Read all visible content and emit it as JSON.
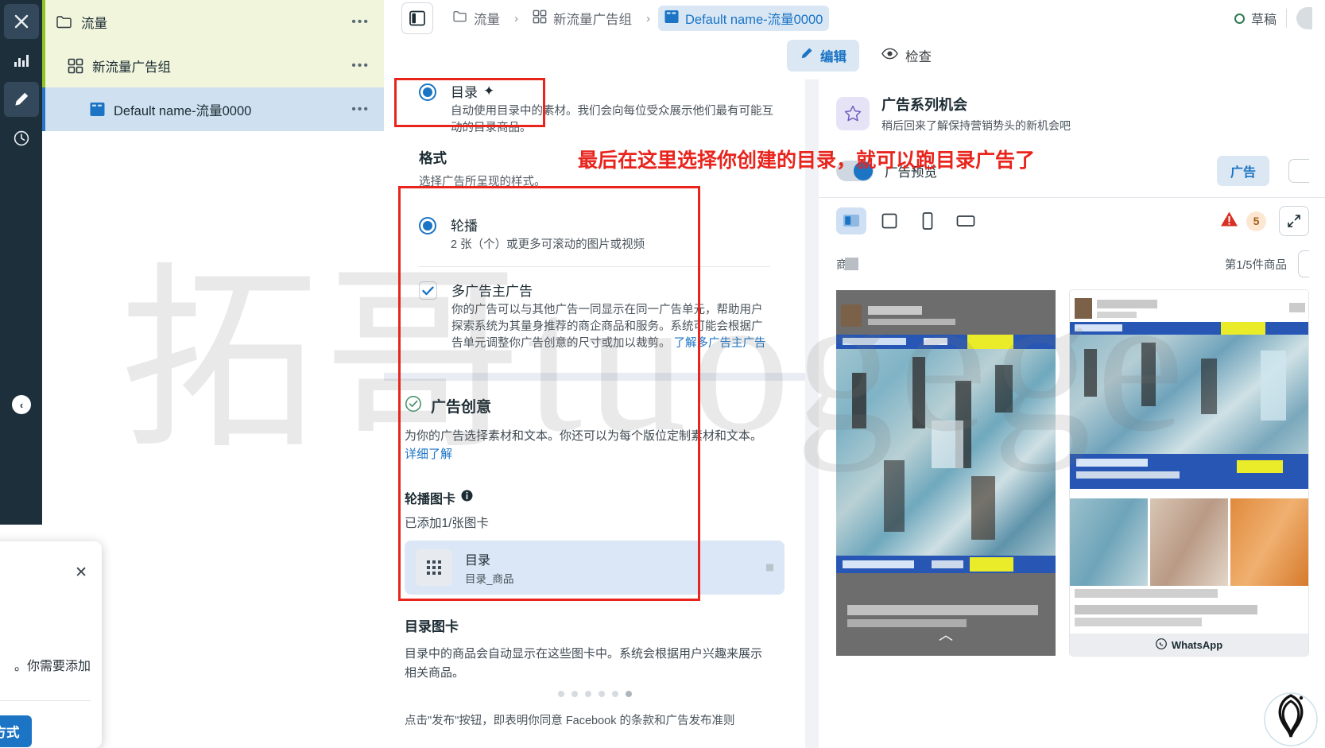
{
  "watermark": "拓哥tuogege",
  "rail": {
    "items": [
      {
        "name": "close-icon",
        "label": "关闭"
      },
      {
        "name": "chart-icon",
        "label": "数据"
      },
      {
        "name": "pencil-icon",
        "label": "编辑"
      },
      {
        "name": "clock-icon",
        "label": "历史"
      }
    ],
    "collapse_label": "‹"
  },
  "tree": {
    "rows": [
      {
        "icon": "folder-icon",
        "label": "流量",
        "level": 1,
        "menu": "•••"
      },
      {
        "icon": "adset-grid-icon",
        "label": "新流量广告组",
        "level": 2,
        "menu": "•••"
      },
      {
        "icon": "ad-card-icon",
        "label": "Default name-流量0000",
        "level": 3,
        "menu": "•••"
      }
    ]
  },
  "topbar": {
    "panel_toggle": "panel-toggle-icon",
    "breadcrumbs": [
      {
        "icon": "folder-icon",
        "label": "流量",
        "current": false
      },
      {
        "icon": "adset-grid-icon",
        "label": "新流量广告组",
        "current": false
      },
      {
        "icon": "ad-card-icon",
        "label": "Default name-流量0000",
        "current": true
      }
    ],
    "separator": "›",
    "status": "草稿"
  },
  "actions": {
    "edit": "编辑",
    "inspect": "检查"
  },
  "form": {
    "catalog_option": {
      "title": "目录",
      "sparkle": "✦",
      "desc": "自动使用目录中的素材。我们会向每位受众展示他们最有可能互动的目录商品。",
      "selected": true
    },
    "format_section": {
      "title": "格式",
      "subtitle": "选择广告所呈现的样式。"
    },
    "carousel_option": {
      "title": "轮播",
      "desc": "2 张（个）或更多可滚动的图片或视频",
      "selected": true
    },
    "multi_advertiser": {
      "title": "多广告主广告",
      "desc": "你的广告可以与其他广告一同显示在同一广告单元，帮助用户探索系统为其量身推荐的商企商品和服务。系统可能会根据广告单元调整你广告创意的尺寸或加以裁剪。",
      "link": "了解多广告主广告",
      "checked": true
    },
    "creative": {
      "title": "广告创意",
      "desc": "为你的广告选择素材和文本。你还可以为每个版位定制素材和文本。",
      "link": "详细了解"
    },
    "carousel_cards": {
      "label": "轮播图卡",
      "info_icon": "info-icon",
      "count_text": "已添加1/张图卡",
      "asset": {
        "icon": "grid-thumb-icon",
        "name": "目录",
        "sub": "目录_商品"
      }
    },
    "catalog_cards": {
      "title": "目录图卡",
      "desc": "目录中的商品会自动显示在这些图卡中。系统会根据用户兴趣来展示相关商品。"
    },
    "footnote": "点击\"发布\"按钮，即表明你同意 Facebook 的条款和广告发布准则"
  },
  "preview": {
    "opportunity": {
      "icon": "star-icon",
      "title": "广告系列机会",
      "desc": "稍后回来了解保持营销势头的新机会吧"
    },
    "toggle_label": "广告预览",
    "toggle_on": true,
    "tab_label": "广告",
    "device_icons": [
      {
        "name": "desktop-feed-icon",
        "active": true
      },
      {
        "name": "square-icon",
        "active": false
      },
      {
        "name": "mobile-icon",
        "active": false
      },
      {
        "name": "landscape-icon",
        "active": false
      }
    ],
    "warning_icon": "warning-triangle-icon",
    "warning_count": "5",
    "expand_icon": "expand-icon",
    "meta_left": "商品",
    "meta_right": "第1/5件商品",
    "whatsapp_label": "WhatsApp",
    "chevron_up": "︿"
  },
  "payment_popup": {
    "close_icon": "close-icon",
    "text": "。你需要添加",
    "button": "添加支付方式"
  },
  "annotations": {
    "note": "最后在这里选择你创建的目录，就可以跑目录广告了",
    "color": "#e8241d"
  }
}
